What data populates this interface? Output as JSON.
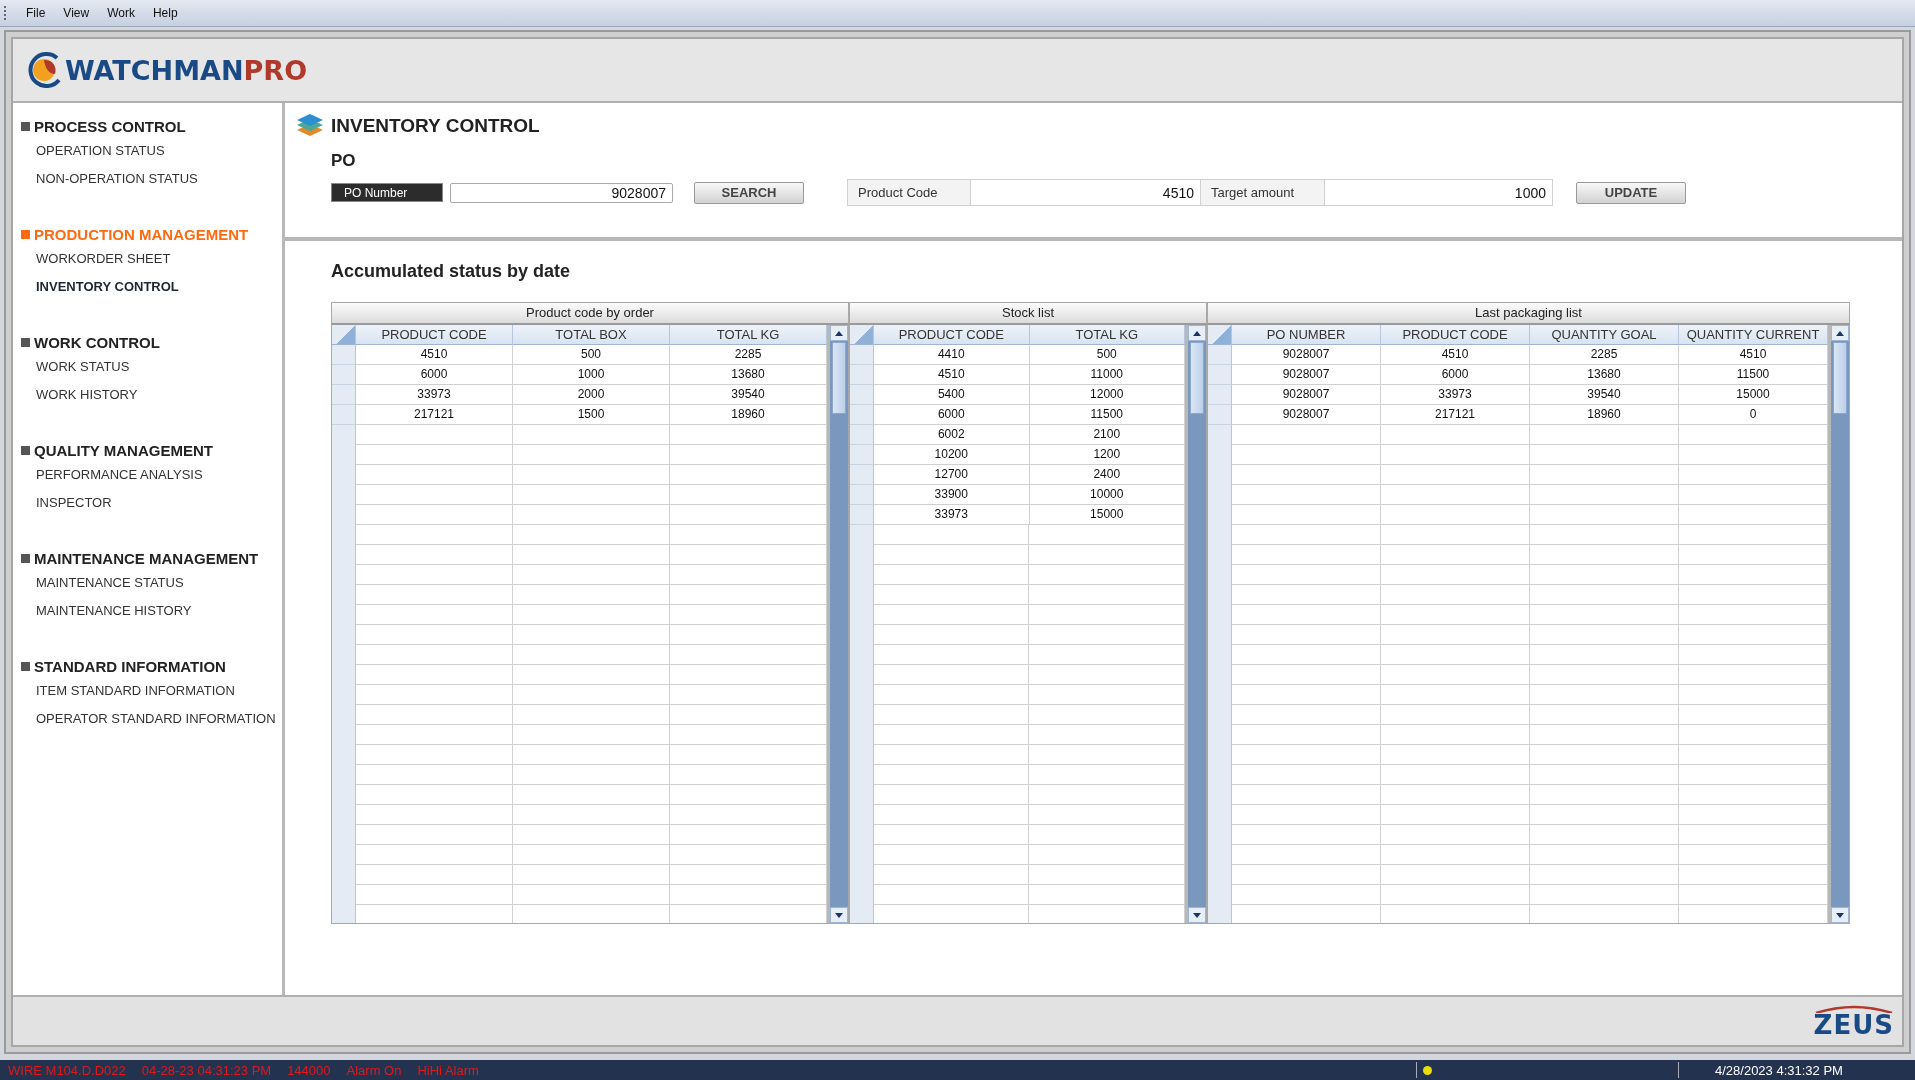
{
  "menu": [
    {
      "label": "File"
    },
    {
      "label": "View"
    },
    {
      "label": "Work"
    },
    {
      "label": "Help"
    }
  ],
  "logo": {
    "text_main": "WATCHMAN",
    "text_accent": "PRO"
  },
  "sidebar": {
    "groups": [
      {
        "title": "PROCESS CONTROL",
        "selected": false,
        "items": [
          {
            "label": "OPERATION STATUS",
            "selected": false
          },
          {
            "label": "NON-OPERATION STATUS",
            "selected": false
          }
        ]
      },
      {
        "title": "PRODUCTION MANAGEMENT",
        "selected": true,
        "items": [
          {
            "label": "WORKORDER SHEET",
            "selected": false
          },
          {
            "label": "INVENTORY CONTROL",
            "selected": true
          }
        ]
      },
      {
        "title": "WORK CONTROL",
        "selected": false,
        "items": [
          {
            "label": "WORK STATUS",
            "selected": false
          },
          {
            "label": "WORK HISTORY",
            "selected": false
          }
        ]
      },
      {
        "title": "QUALITY MANAGEMENT",
        "selected": false,
        "items": [
          {
            "label": "PERFORMANCE ANALYSIS",
            "selected": false
          },
          {
            "label": "INSPECTOR",
            "selected": false
          }
        ]
      },
      {
        "title": "MAINTENANCE MANAGEMENT",
        "selected": false,
        "items": [
          {
            "label": "MAINTENANCE STATUS",
            "selected": false
          },
          {
            "label": "MAINTENANCE HISTORY",
            "selected": false
          }
        ]
      },
      {
        "title": "STANDARD INFORMATION",
        "selected": false,
        "items": [
          {
            "label": "ITEM STANDARD INFORMATION",
            "selected": false
          },
          {
            "label": "OPERATOR STANDARD INFORMATION",
            "selected": false
          }
        ]
      }
    ]
  },
  "page_title": "INVENTORY CONTROL",
  "po_section": {
    "title": "PO",
    "po_number": {
      "label": "PO Number",
      "value": "9028007"
    },
    "search_button": "SEARCH",
    "product_code": {
      "label": "Product Code",
      "value": "4510"
    },
    "target_amount": {
      "label": "Target amount",
      "value": "1000"
    },
    "update_button": "UPDATE"
  },
  "status_title": "Accumulated status by date",
  "tables": [
    {
      "title": "Product code by order",
      "columns": [
        "PRODUCT CODE",
        "TOTAL BOX",
        "TOTAL KG"
      ],
      "rows": [
        [
          "4510",
          "500",
          "2285"
        ],
        [
          "6000",
          "1000",
          "13680"
        ],
        [
          "33973",
          "2000",
          "39540"
        ],
        [
          "217121",
          "1500",
          "18960"
        ]
      ]
    },
    {
      "title": "Stock list",
      "columns": [
        "PRODUCT CODE",
        "TOTAL KG"
      ],
      "rows": [
        [
          "4410",
          "500"
        ],
        [
          "4510",
          "11000"
        ],
        [
          "5400",
          "12000"
        ],
        [
          "6000",
          "11500"
        ],
        [
          "6002",
          "2100"
        ],
        [
          "10200",
          "1200"
        ],
        [
          "12700",
          "2400"
        ],
        [
          "33900",
          "10000"
        ],
        [
          "33973",
          "15000"
        ]
      ]
    },
    {
      "title": "Last packaging list",
      "columns": [
        "PO NUMBER",
        "PRODUCT CODE",
        "QUANTITY GOAL",
        "QUANTITY CURRENT"
      ],
      "rows": [
        [
          "9028007",
          "4510",
          "2285",
          "4510"
        ],
        [
          "9028007",
          "6000",
          "13680",
          "11500"
        ],
        [
          "9028007",
          "33973",
          "39540",
          "15000"
        ],
        [
          "9028007",
          "217121",
          "18960",
          "0"
        ]
      ]
    }
  ],
  "footer_logo": "ZEUS",
  "status_bar": {
    "alarms": [
      "WIRE M104.D.D022",
      "04-28-23 04:31:23 PM",
      "144000",
      "Alarm On",
      "HiHi Alarm"
    ],
    "datetime": "4/28/2023 4:31:32 PM"
  }
}
